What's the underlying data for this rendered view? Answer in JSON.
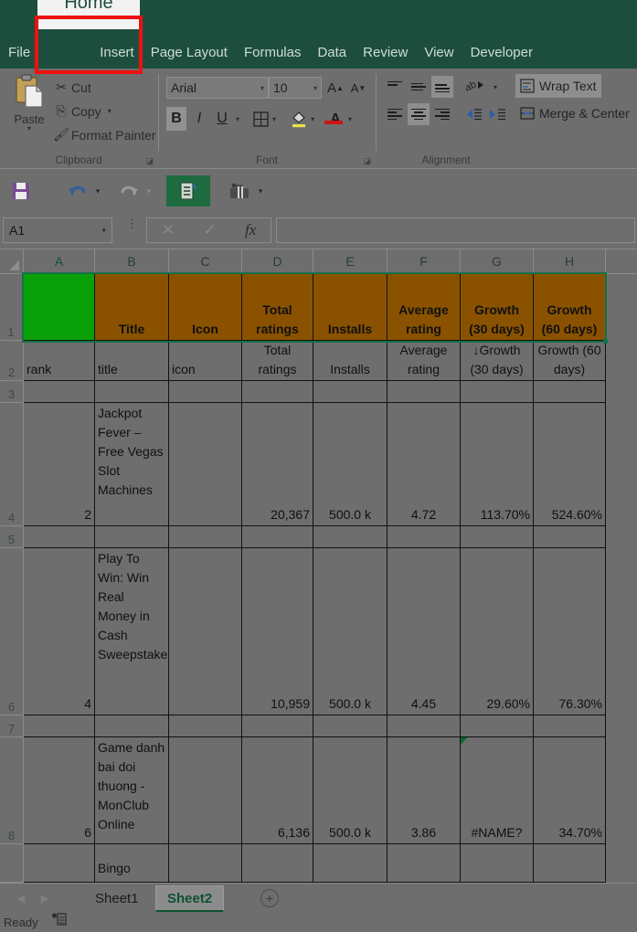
{
  "ribbon": {
    "tabs": [
      {
        "label": "File"
      },
      {
        "label": "Home"
      },
      {
        "label": "Insert"
      },
      {
        "label": "Page Layout"
      },
      {
        "label": "Formulas"
      },
      {
        "label": "Data"
      },
      {
        "label": "Review"
      },
      {
        "label": "View"
      },
      {
        "label": "Developer"
      }
    ],
    "active_tab": "Home",
    "groups": {
      "clipboard": {
        "label": "Clipboard",
        "paste": "Paste",
        "cut": "Cut",
        "copy": "Copy",
        "format_painter": "Format Painter"
      },
      "font": {
        "label": "Font",
        "font_name": "Arial",
        "font_size": "10",
        "bold": "B",
        "italic": "I",
        "underline": "U",
        "grow_font": "A",
        "shrink_font": "A",
        "font_color": "A"
      },
      "alignment": {
        "label": "Alignment",
        "wrap_text": "Wrap Text",
        "merge_center": "Merge & Center"
      }
    }
  },
  "formula_bar": {
    "name_box": "A1",
    "formula": "",
    "cancel_icon": "✕",
    "enter_icon": "✓",
    "fx_icon": "fx"
  },
  "grid": {
    "columns": [
      "A",
      "B",
      "C",
      "D",
      "E",
      "F",
      "G",
      "H"
    ],
    "rows": [
      "1",
      "2",
      "3",
      "4",
      "5",
      "6",
      "7",
      "8"
    ],
    "header_row": [
      "",
      "Title",
      "Icon",
      "Total ratings",
      "Installs",
      "Average rating",
      "Growth (30 days)",
      "Growth (60 days)"
    ],
    "field_row": [
      "rank",
      "title",
      "icon",
      "Total ratings",
      "Installs",
      "Average rating",
      "↓Growth (30 days)",
      "Growth (60 days)"
    ],
    "data_rows": [
      {
        "row": "4",
        "rank": "2",
        "title": "Jackpot Fever – Free Vegas Slot Machines",
        "icon": "",
        "total_ratings": "20,367",
        "installs": "500.0 k",
        "average_rating": "4.72",
        "growth_30": "113.70%",
        "growth_60": "524.60%",
        "error_flag": false
      },
      {
        "row": "6",
        "rank": "4",
        "title": "Play To Win: Win Real Money in Cash Sweepstakes",
        "icon": "",
        "total_ratings": "10,959",
        "installs": "500.0 k",
        "average_rating": "4.45",
        "growth_30": "29.60%",
        "growth_60": "76.30%",
        "error_flag": false
      },
      {
        "row": "8",
        "rank": "6",
        "title": "Game danh bai doi thuong - MonClub Online",
        "icon": "",
        "total_ratings": "6,136",
        "installs": "500.0 k",
        "average_rating": "3.86",
        "growth_30": "#NAME?",
        "growth_60": "34.70%",
        "error_flag": true
      }
    ],
    "partial_row_title": "Bingo",
    "selected_cell": "A1"
  },
  "sheet_tabs": {
    "tabs": [
      "Sheet1",
      "Sheet2"
    ],
    "active": "Sheet2",
    "add_label": "+",
    "prev_label": "◀",
    "next_label": "▶"
  },
  "status_bar": {
    "mode": "Ready"
  },
  "colors": {
    "ribbon_bg": "#1d4e3d",
    "header_fill": "#8a5200",
    "rank_fill": "#0aa00a",
    "annotation": "#ee1111",
    "selection": "#15704a"
  }
}
